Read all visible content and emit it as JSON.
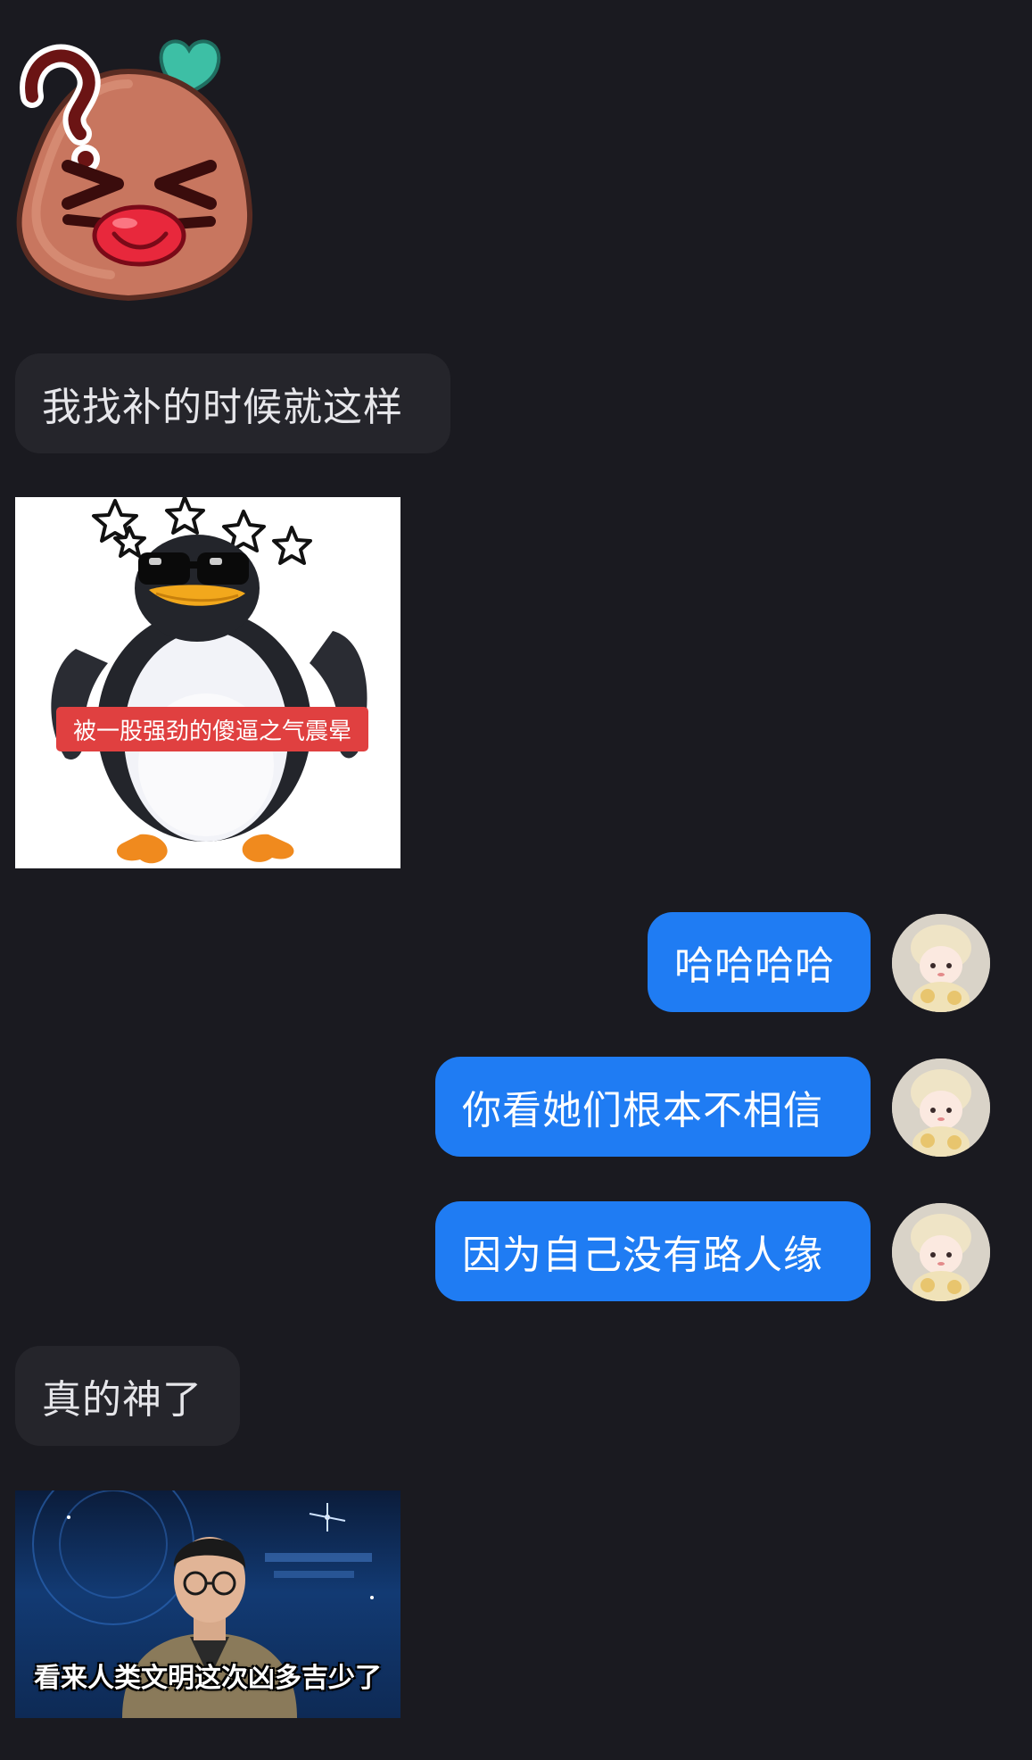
{
  "messages": {
    "m1": {
      "text": "我找补的时候就这样"
    },
    "m2": {
      "caption": "被一股强劲的傻逼之气震晕"
    },
    "m3": {
      "text": "哈哈哈哈"
    },
    "m4": {
      "text": "你看她们根本不相信"
    },
    "m5": {
      "text": "因为自己没有路人缘"
    },
    "m6": {
      "text": "真的神了"
    },
    "m7": {
      "caption": "看来人类文明这次凶多吉少了"
    }
  },
  "colors": {
    "background": "#1a1a20",
    "incoming_bubble": "#25252b",
    "outgoing_bubble": "#1f7cf3"
  },
  "icons": {
    "sticker": "question-blob-face",
    "avatar": "plush-doll-avatar"
  }
}
